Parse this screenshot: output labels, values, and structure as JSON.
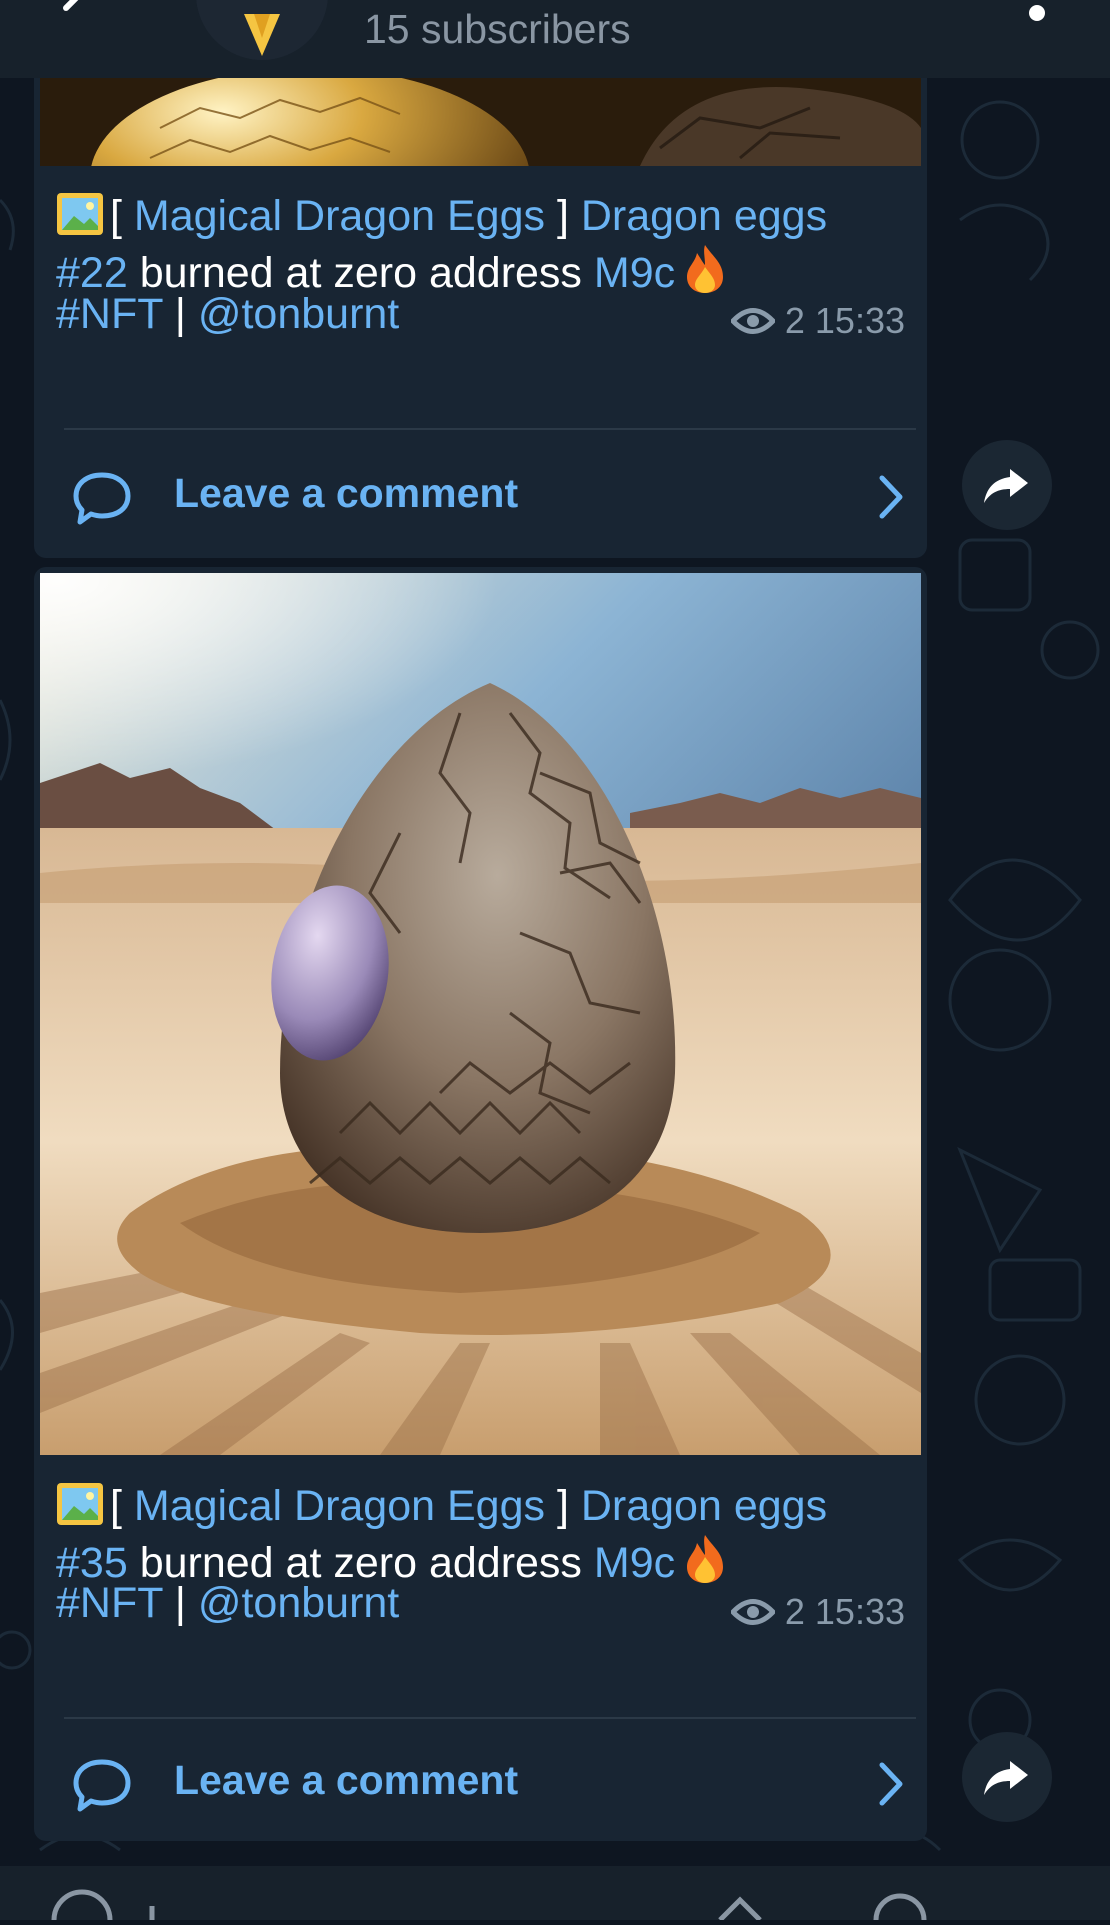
{
  "header": {
    "subscribers": "15 subscribers",
    "icons": {
      "back": "back-arrow-icon",
      "menu": "more-dots-icon"
    }
  },
  "posts": [
    {
      "collection": "Magical Dragon Eggs",
      "title_a": "Dragon eggs",
      "number": "#22",
      "text": "burned at zero address",
      "address": "M9c",
      "hashtag": "#NFT",
      "separator": "|",
      "mention": "@tonburnt",
      "views": "2",
      "time": "15:33",
      "comment_label": "Leave a comment",
      "image": "golden dragon egg (cropped)"
    },
    {
      "collection": "Magical Dragon Eggs",
      "title_a": "Dragon eggs",
      "number": "#35",
      "text": "burned at zero address",
      "address": "M9c",
      "hashtag": "#NFT",
      "separator": "|",
      "mention": "@tonburnt",
      "views": "2",
      "time": "15:33",
      "comment_label": "Leave a comment",
      "image": "scaled dragon egg in desert"
    }
  ],
  "colors": {
    "background": "#0e1621",
    "bubble": "#182533",
    "link": "#6ab3f3",
    "meta": "#8a9bab"
  }
}
